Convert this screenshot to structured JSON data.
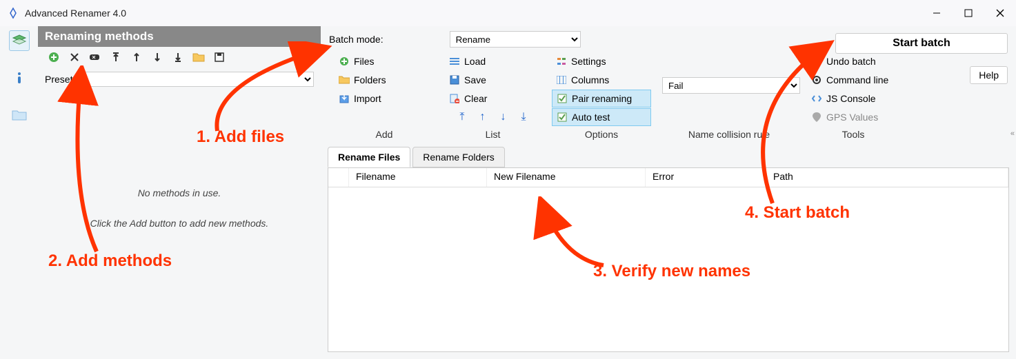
{
  "window": {
    "title": "Advanced Renamer 4.0"
  },
  "methods": {
    "header": "Renaming methods",
    "presets_label": "Presets",
    "no_methods": "No methods in use.",
    "hint": "Click the Add button to add new methods."
  },
  "batch": {
    "mode_label": "Batch mode:",
    "mode_value": "Rename",
    "start_label": "Start batch",
    "help_label": "Help"
  },
  "add": {
    "files": "Files",
    "folders": "Folders",
    "import": "Import",
    "label": "Add"
  },
  "list": {
    "load": "Load",
    "save": "Save",
    "clear": "Clear",
    "label": "List"
  },
  "options": {
    "settings": "Settings",
    "columns": "Columns",
    "pair": "Pair renaming",
    "auto": "Auto test",
    "label": "Options"
  },
  "collision": {
    "value": "Fail",
    "label": "Name collision rule"
  },
  "tools": {
    "undo": "Undo batch",
    "cmd": "Command line",
    "js": "JS Console",
    "gps": "GPS Values",
    "label": "Tools"
  },
  "tabs": {
    "files": "Rename Files",
    "folders": "Rename Folders"
  },
  "table": {
    "filename": "Filename",
    "newfilename": "New Filename",
    "error": "Error",
    "path": "Path"
  },
  "annotations": {
    "one": "1. Add files",
    "two": "2. Add methods",
    "three": "3. Verify new names",
    "four": "4. Start batch"
  }
}
